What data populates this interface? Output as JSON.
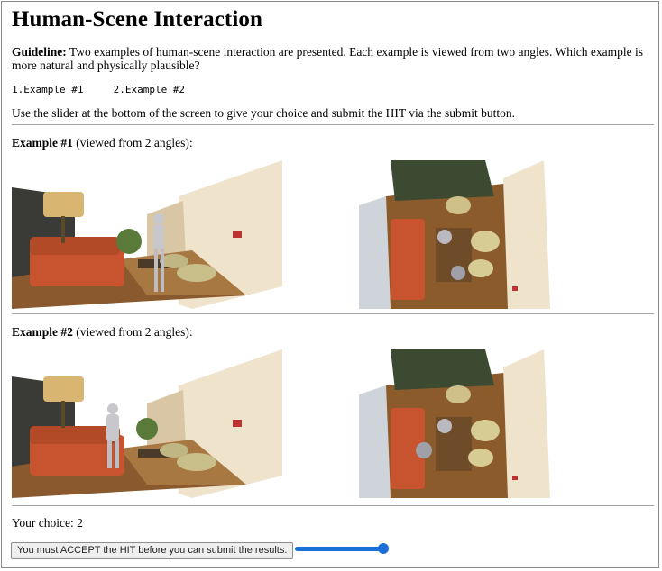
{
  "page": {
    "title": "Human-Scene Interaction",
    "guideline_label": "Guideline:",
    "guideline_text": " Two examples of human-scene interaction are presented. Each example is viewed from two angles. Which example is more natural and physically plausible?",
    "options_text": "1.Example #1     2.Example #2",
    "instruction": "Use the slider at the bottom of the screen to give your choice and submit the HIT via the submit button."
  },
  "examples": [
    {
      "label": "Example #1",
      "caption": " (viewed from 2 angles):"
    },
    {
      "label": "Example #2",
      "caption": " (viewed from 2 angles):"
    }
  ],
  "choice": {
    "prefix": "Your choice: ",
    "value": "2"
  },
  "submit": {
    "label": "You must ACCEPT the HIT before you can submit the results."
  },
  "slider": {
    "min": 1,
    "max": 2,
    "value": 2
  },
  "colors": {
    "slider_accent": "#1a6fd8",
    "sofa": "#c8542f",
    "wall": "#f2e7d2",
    "floor": "#9b6a3a"
  }
}
